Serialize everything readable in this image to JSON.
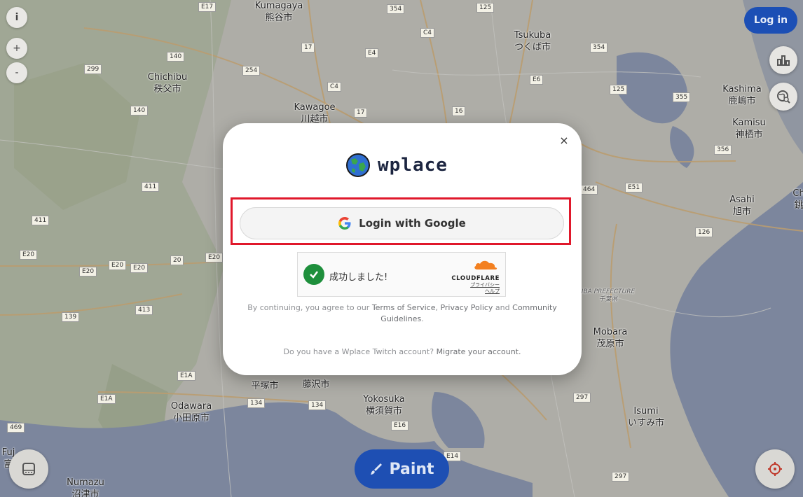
{
  "map": {
    "cities": [
      {
        "id": "kumagaya",
        "en": "Kumagaya",
        "jp": "熊谷市"
      },
      {
        "id": "tsukuba",
        "en": "Tsukuba",
        "jp": "つくば市"
      },
      {
        "id": "chichibu",
        "en": "Chichibu",
        "jp": "秩父市"
      },
      {
        "id": "kawagoe",
        "en": "Kawagoe",
        "jp": "川越市"
      },
      {
        "id": "kashima",
        "en": "Kashima",
        "jp": "鹿嶋市"
      },
      {
        "id": "kamisu",
        "en": "Kamisu",
        "jp": "神栖市"
      },
      {
        "id": "asahi",
        "en": "Asahi",
        "jp": "旭市"
      },
      {
        "id": "mobara",
        "en": "Mobara",
        "jp": "茂原市"
      },
      {
        "id": "isumi",
        "en": "Isumi",
        "jp": "いすみ市"
      },
      {
        "id": "yokosuka",
        "en": "Yokosuka",
        "jp": "横須賀市"
      },
      {
        "id": "odawara",
        "en": "Odawara",
        "jp": "小田原市"
      },
      {
        "id": "numazu",
        "en": "Numazu",
        "jp": "沼津市"
      },
      {
        "id": "hiratsuka",
        "en": "",
        "jp": "平塚市"
      },
      {
        "id": "fujisawa",
        "en": "",
        "jp": "藤沢市"
      }
    ],
    "routes": [
      "E17",
      "354",
      "125",
      "17",
      "C4",
      "254",
      "299",
      "140",
      "E4",
      "E6",
      "125",
      "354",
      "C4",
      "17",
      "16",
      "355",
      "140",
      "411",
      "411",
      "E20",
      "E20",
      "E20",
      "E20",
      "20",
      "E20",
      "139",
      "413",
      "E1A",
      "E1A",
      "134",
      "134",
      "E16",
      "297",
      "469",
      "E14",
      "297",
      "356",
      "126",
      "464",
      "E51"
    ],
    "prefecture_label": "CHIBA PREFECTURE",
    "prefecture_label_visible": "IBA PREFECTURE",
    "prefecture_jp": "千葉県",
    "edge_chars": [
      "Fuj",
      "富",
      "Ch",
      "銚"
    ]
  },
  "controls": {
    "info": "i",
    "zoom_in": "+",
    "zoom_out": "-"
  },
  "header": {
    "login_label": "Log in"
  },
  "paint_label": "Paint",
  "modal": {
    "close_symbol": "×",
    "logo_text": "wplace",
    "google_button_label": "Login with Google",
    "turnstile": {
      "status_text": "成功しました!",
      "brand": "CLOUDFLARE",
      "privacy": "プライバシー",
      "help": "ヘルプ"
    },
    "terms": {
      "prefix": "By continuing, you agree to our ",
      "tos": "Terms of Service",
      "comma": ", ",
      "privacy": "Privacy Policy",
      "and": " and ",
      "guidelines": "Community Guidelines",
      "suffix": "."
    },
    "migrate": {
      "question": "Do you have a Wplace Twitch account? ",
      "link": "Migrate your account."
    }
  },
  "colors": {
    "highlight": "#e0182b",
    "accent": "#1c4fb5",
    "sea": "#7f8fb4",
    "land": "#d6d3c6"
  }
}
